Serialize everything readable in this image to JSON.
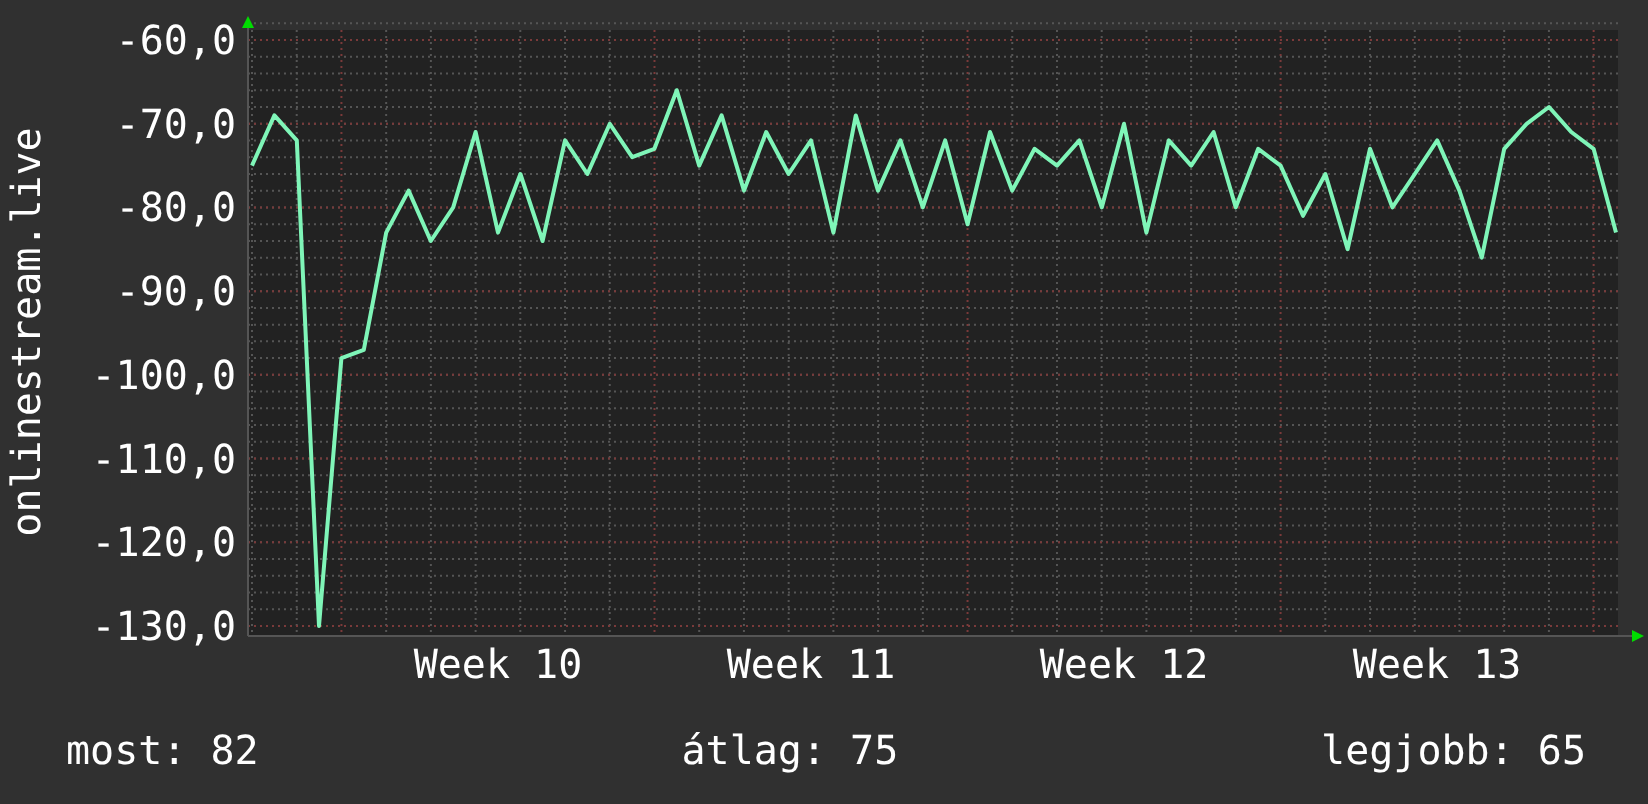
{
  "graph": {
    "chart_data": {
      "type": "line",
      "grid": true,
      "ylabel": "onlinestream.live",
      "ylim": [
        -130,
        -60
      ],
      "yticks": [
        {
          "value": -60,
          "label": "-60,0"
        },
        {
          "value": -70,
          "label": "-70,0"
        },
        {
          "value": -80,
          "label": "-80,0"
        },
        {
          "value": -90,
          "label": "-90,0"
        },
        {
          "value": -100,
          "label": "-100,0"
        },
        {
          "value": -110,
          "label": "-110,0"
        },
        {
          "value": -120,
          "label": "-120,0"
        },
        {
          "value": -130,
          "label": "-130,0"
        }
      ],
      "categories": [
        null,
        null,
        null,
        null,
        null,
        null,
        null,
        null,
        null,
        null,
        null,
        "Week 10",
        null,
        null,
        null,
        null,
        null,
        null,
        null,
        null,
        null,
        null,
        null,
        null,
        null,
        "Week 11",
        null,
        null,
        null,
        null,
        null,
        null,
        null,
        null,
        null,
        null,
        null,
        null,
        null,
        "Week 12",
        null,
        null,
        null,
        null,
        null,
        null,
        null,
        null,
        null,
        null,
        null,
        null,
        null,
        "Week 13",
        null,
        null,
        null,
        null,
        null,
        null,
        null,
        null
      ],
      "series": [
        {
          "color": "#7ff5b8",
          "values": [
            -75,
            -69,
            -72,
            -130,
            -98,
            -97,
            -83,
            -78,
            -84,
            -80,
            -71,
            -83,
            -76,
            -84,
            -72,
            -76,
            -70,
            -74,
            -73,
            -66,
            -75,
            -69,
            -78,
            -71,
            -76,
            -72,
            -83,
            -69,
            -78,
            -72,
            -80,
            -72,
            -82,
            -71,
            -78,
            -73,
            -75,
            -72,
            -80,
            -70,
            -83,
            -72,
            -75,
            -71,
            -80,
            -73,
            -75,
            -81,
            -76,
            -85,
            -73,
            -80,
            -76,
            -72,
            -78,
            -86,
            -73,
            -70,
            -68,
            -71,
            -73,
            -83
          ]
        }
      ]
    }
  },
  "stats": [
    "most: 82",
    "átlag: 75",
    "legjobb: 65"
  ]
}
